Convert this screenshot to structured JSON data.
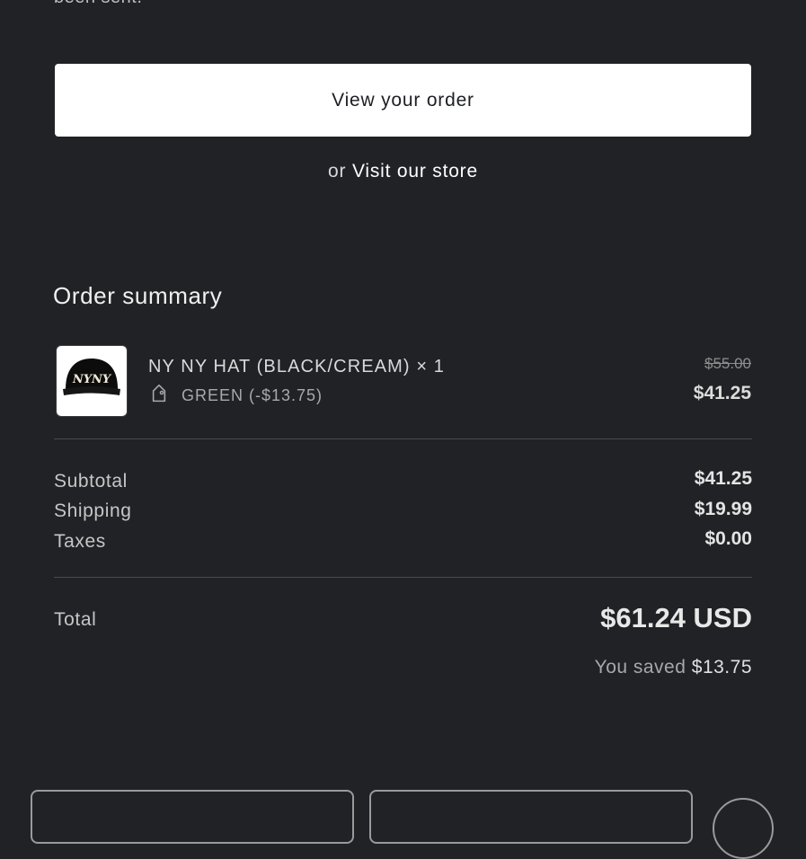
{
  "confirmation": {
    "text": "been sent."
  },
  "actions": {
    "view_order_label": "View your order",
    "or_text": "or",
    "visit_store_label": "Visit our store"
  },
  "order_summary": {
    "title": "Order summary",
    "item": {
      "name": "NY NY HAT (BLACK/CREAM) × 1",
      "discount": "GREEN (-$13.75)",
      "original_price": "$55.00",
      "price": "$41.25",
      "thumbnail_logo": "NYNY",
      "icon": "tag-icon"
    },
    "rows": [
      {
        "label": "Subtotal",
        "value": "$41.25"
      },
      {
        "label": "Shipping",
        "value": "$19.99"
      },
      {
        "label": "Taxes",
        "value": "$0.00"
      }
    ],
    "total": {
      "label": "Total",
      "value": "$61.24 USD"
    },
    "saved": {
      "label": "You saved",
      "amount": "$13.75"
    }
  },
  "colors": {
    "background": "#212226",
    "button": "#ffffff",
    "button_text": "#1e1f23"
  }
}
